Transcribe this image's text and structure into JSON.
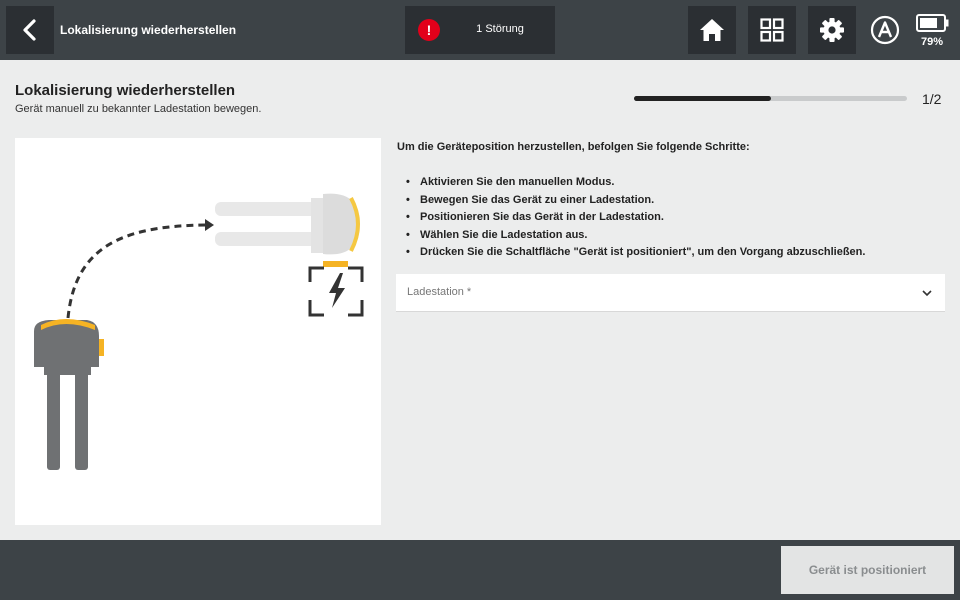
{
  "topbar": {
    "title": "Lokalisierung wiederherstellen",
    "fault_icon": "!",
    "fault_label": "1 Störung",
    "battery_percent": "79%",
    "icons": [
      "back-arrow-icon",
      "alert-icon",
      "home-icon",
      "grid-icon",
      "gear-icon",
      "auto-mode-icon",
      "battery-icon"
    ]
  },
  "header": {
    "title": "Lokalisierung wiederherstellen",
    "subtitle": "Gerät manuell zu bekannter Ladestation bewegen.",
    "step_label": "1/2",
    "progress_fraction": 0.5
  },
  "instructions": {
    "intro": "Um die Geräteposition herzustellen, befolgen Sie folgende Schritte:",
    "steps": [
      "Aktivieren Sie den manuellen Modus.",
      "Bewegen Sie das Gerät zu einer Ladestation.",
      "Positionieren Sie das Gerät in der Ladestation.",
      "Wählen Sie die Ladestation aus.",
      "Drücken Sie die Schaltfläche \"Gerät ist positioniert\", um den Vorgang abzuschließen."
    ]
  },
  "station_select": {
    "placeholder": "Ladestation *"
  },
  "footer": {
    "confirm_label": "Gerät ist positioniert"
  },
  "colors": {
    "topbar_bg": "#3d4347",
    "button_bg": "#2b2f33",
    "alert_red": "#e2001a",
    "accent_yellow": "#f5b324",
    "page_bg": "#eceded"
  }
}
